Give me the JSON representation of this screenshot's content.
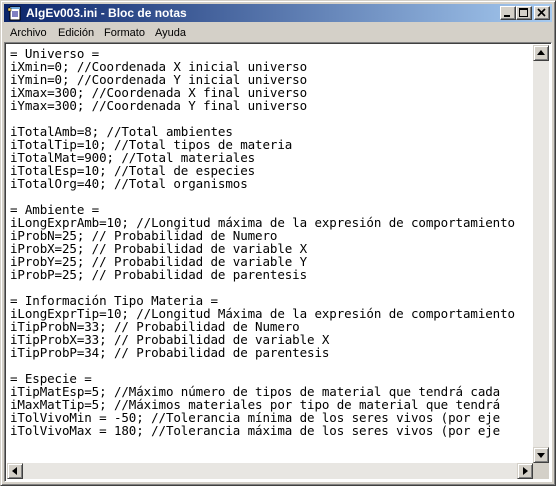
{
  "window": {
    "title": "AlgEv003.ini - Bloc de notas",
    "icon": "notepad-icon"
  },
  "menu": {
    "items": [
      "Archivo",
      "Edición",
      "Formato",
      "Ayuda"
    ]
  },
  "editor": {
    "lines": [
      "= Universo =",
      "iXmin=0; //Coordenada X inicial universo",
      "iYmin=0; //Coordenada Y inicial universo",
      "iXmax=300; //Coordenada X final universo",
      "iYmax=300; //Coordenada Y final universo",
      "",
      "iTotalAmb=8; //Total ambientes",
      "iTotalTip=10; //Total tipos de materia",
      "iTotalMat=900; //Total materiales",
      "iTotalEsp=10; //Total de especies",
      "iTotalOrg=40; //Total organismos",
      "",
      "= Ambiente =",
      "iLongExprAmb=10; //Longitud máxima de la expresión de comportamiento",
      "iProbN=25; // Probabilidad de Numero",
      "iProbX=25; // Probabilidad de variable X",
      "iProbY=25; // Probabilidad de variable Y",
      "iProbP=25; // Probabilidad de parentesis",
      "",
      "= Información Tipo Materia =",
      "iLongExprTip=10; //Longitud Máxima de la expresión de comportamiento",
      "iTipProbN=33; // Probabilidad de Numero",
      "iTipProbX=33; // Probabilidad de variable X",
      "iTipProbP=34; // Probabilidad de parentesis",
      "",
      "= Especie =",
      "iTipMatEsp=5; //Máximo número de tipos de material que tendrá cada",
      "iMaxMatTip=5; //Máximos materiales por tipo de material que tendrá",
      "iTolVivoMin = -50; //Tolerancia mínima de los seres vivos (por eje",
      "iTolVivoMax = 180; //Tolerancia máxima de los seres vivos (por eje"
    ]
  },
  "colors": {
    "titlebar_start": "#0a246a",
    "titlebar_end": "#a6caf0",
    "chrome": "#d4d0c8"
  }
}
